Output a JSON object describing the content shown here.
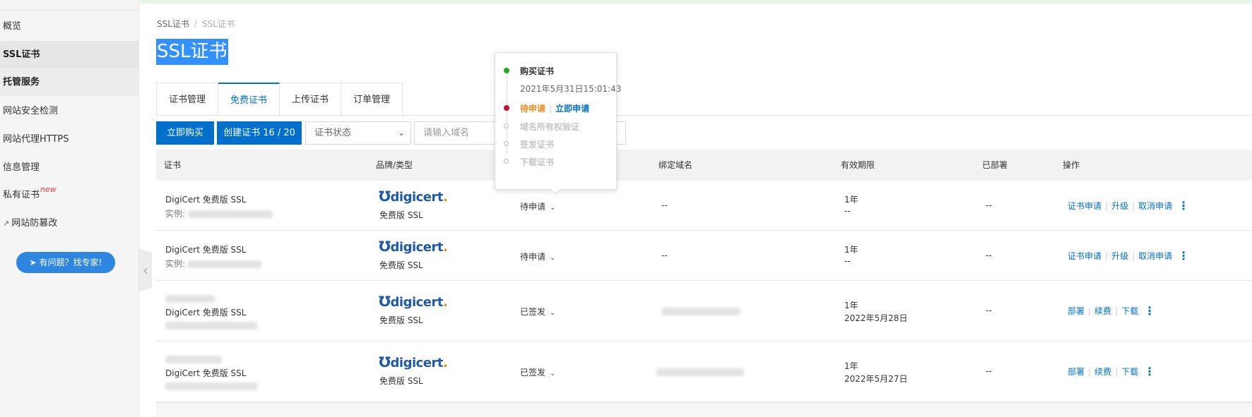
{
  "sidebar": {
    "items": [
      {
        "label": "概览"
      },
      {
        "label": "SSL证书"
      },
      {
        "label": "托管服务"
      },
      {
        "label": "网站安全检测"
      },
      {
        "label": "网站代理HTTPS"
      },
      {
        "label": "信息管理"
      },
      {
        "label": "私有证书",
        "badge": "new"
      },
      {
        "label": "网站防篡改",
        "icon": "link-icon"
      }
    ],
    "help_button": "有问题？找专家!"
  },
  "breadcrumb": [
    "SSL证书",
    "/",
    "SSL证书"
  ],
  "page_title": "SSL证书",
  "tabs": [
    "证书管理",
    "免费证书",
    "上传证书",
    "订单管理"
  ],
  "active_tab": "免费证书",
  "toolbar": {
    "buy_label": "立即购买",
    "create_label": "创建证书 16 / 20",
    "status_select": "证书状态",
    "search_placeholder": "请输入域名"
  },
  "table": {
    "headers": [
      "证书",
      "品牌/类型",
      "状态",
      "绑定域名",
      "有效期限",
      "已部署",
      "操作"
    ],
    "rows": [
      {
        "name": "DigiCert 免费版 SSL",
        "instance_prefix": "实例: ",
        "brand": "digicert",
        "type": "免费版 SSL",
        "status": "待申请",
        "domain": "--",
        "validity": "1年",
        "expire": "--",
        "deployed": "--",
        "ops": [
          "证书申请",
          "升级",
          "取消申请"
        ]
      },
      {
        "name": "DigiCert 免费版 SSL",
        "instance_prefix": "实例: ",
        "brand": "digicert",
        "type": "免费版 SSL",
        "status": "待申请",
        "domain": "--",
        "validity": "1年",
        "expire": "--",
        "deployed": "--",
        "ops": [
          "证书申请",
          "升级",
          "取消申请"
        ]
      },
      {
        "name": "DigiCert 免费版 SSL",
        "brand": "digicert",
        "type": "免费版 SSL",
        "status": "已签发",
        "validity": "1年",
        "expire": "2022年5月28日",
        "deployed": "--",
        "ops": [
          "部署",
          "续费",
          "下载"
        ]
      },
      {
        "name": "DigiCert 免费版 SSL",
        "brand": "digicert",
        "type": "免费版 SSL",
        "status": "已签发",
        "validity": "1年",
        "expire": "2022年5月27日",
        "deployed": "--",
        "ops": [
          "部署",
          "续费",
          "下载"
        ]
      }
    ]
  },
  "popover": {
    "steps": [
      {
        "label": "购买证书",
        "time": "2021年5月31日15:01:43",
        "state": "done"
      },
      {
        "label": "待申请",
        "action": "立即申请",
        "state": "current"
      },
      {
        "label": "域名所有权验证",
        "state": "todo"
      },
      {
        "label": "签发证书",
        "state": "todo"
      },
      {
        "label": "下载证书",
        "state": "todo"
      }
    ],
    "divider": "|"
  },
  "colors": {
    "primary": "#0070cc",
    "pending": "#f08c1e",
    "success": "#1aad19",
    "danger": "#c8102e"
  }
}
